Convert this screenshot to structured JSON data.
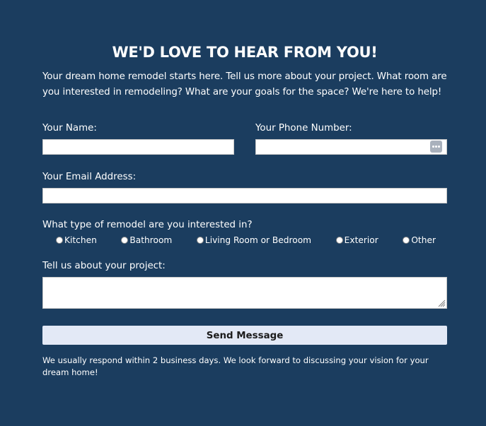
{
  "form": {
    "heading": "WE'D LOVE TO HEAR FROM YOU!",
    "intro": "Your dream home remodel starts here. Tell us more about your project. What room are you interested in remodeling? What are your goals for the space? We're here to help!",
    "name_label": "Your Name:",
    "name_value": "",
    "phone_label": "Your Phone Number:",
    "phone_value": "",
    "phone_icon": "dots-icon",
    "email_label": "Your Email Address:",
    "email_value": "",
    "remodel_label": "What type of remodel are you interested in?",
    "remodel_options": [
      "Kitchen",
      "Bathroom",
      "Living Room or Bedroom",
      "Exterior",
      "Other"
    ],
    "remodel_selected": null,
    "project_label": "Tell us about your project:",
    "project_value": "",
    "send_label": "Send Message",
    "footnote": "We usually respond within 2 business days. We look forward to discussing your vision for your dream home!"
  },
  "colors": {
    "background": "#1b3d5f",
    "text": "#ffffff",
    "button_bg": "#e3e9f6",
    "button_text": "#1c1c1c",
    "field_bg": "#ffffff",
    "phone_icon_bg": "#a9b1bc"
  }
}
